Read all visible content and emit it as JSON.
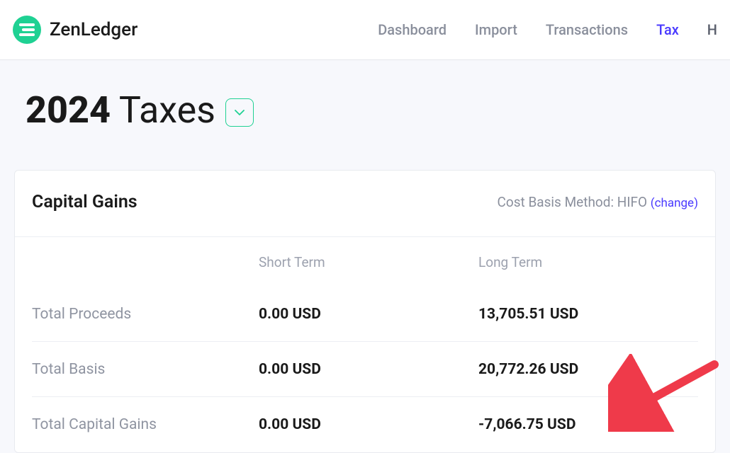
{
  "brand": "ZenLedger",
  "nav": {
    "dashboard": "Dashboard",
    "import": "Import",
    "transactions": "Transactions",
    "tax": "Tax",
    "partial": "H"
  },
  "page": {
    "year": "2024",
    "title_suffix": " Taxes"
  },
  "card": {
    "title": "Capital Gains",
    "cost_basis_label": "Cost Basis Method: ",
    "cost_basis_method": "HIFO",
    "change_label": "(change)"
  },
  "table": {
    "headers": {
      "short_term": "Short Term",
      "long_term": "Long Term"
    },
    "rows": [
      {
        "label": "Total Proceeds",
        "short": "0.00 USD",
        "long": "13,705.51 USD"
      },
      {
        "label": "Total Basis",
        "short": "0.00 USD",
        "long": "20,772.26 USD"
      },
      {
        "label": "Total Capital Gains",
        "short": "0.00 USD",
        "long": "-7,066.75 USD"
      }
    ]
  }
}
